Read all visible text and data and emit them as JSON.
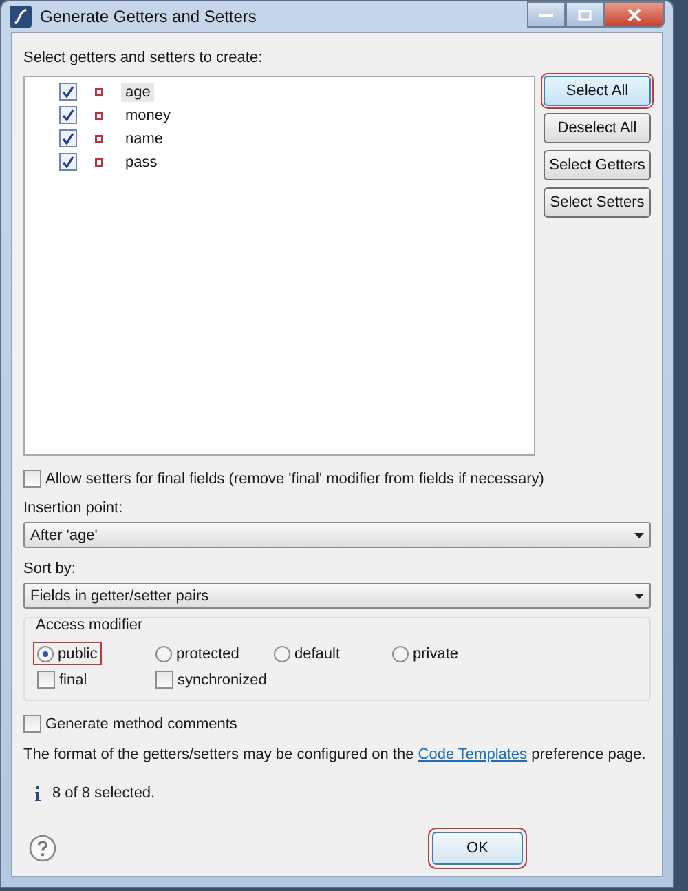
{
  "window": {
    "title": "Generate Getters and Setters"
  },
  "tree": {
    "label": "Select getters and setters to create:",
    "items": [
      {
        "name": "age",
        "checked": true,
        "selected": true
      },
      {
        "name": "money",
        "checked": true,
        "selected": false
      },
      {
        "name": "name",
        "checked": true,
        "selected": false
      },
      {
        "name": "pass",
        "checked": true,
        "selected": false
      }
    ]
  },
  "side_buttons": [
    {
      "label": "Select All",
      "focused": true
    },
    {
      "label": "Deselect All",
      "focused": false
    },
    {
      "label": "Select Getters",
      "focused": false
    },
    {
      "label": "Select Setters",
      "focused": false
    }
  ],
  "allow_final": {
    "label": "Allow setters for final fields (remove 'final' modifier from fields if necessary)",
    "checked": false
  },
  "insertion_point": {
    "label": "Insertion point:",
    "value": "After 'age'"
  },
  "sort_by": {
    "label": "Sort by:",
    "value": "Fields in getter/setter pairs"
  },
  "access_modifier": {
    "title": "Access modifier",
    "radios": [
      {
        "label": "public",
        "selected": true
      },
      {
        "label": "protected",
        "selected": false
      },
      {
        "label": "default",
        "selected": false
      },
      {
        "label": "private",
        "selected": false
      }
    ],
    "checkboxes": [
      {
        "label": "final",
        "checked": false
      },
      {
        "label": "synchronized",
        "checked": false
      }
    ]
  },
  "method_comments": {
    "label": "Generate method comments",
    "checked": false
  },
  "note": {
    "before": "The format of the getters/setters may be configured on the",
    "link": "Code Templates",
    "after": "preference page."
  },
  "status": "8 of 8 selected.",
  "ok_button": {
    "label": "OK",
    "focused": true
  }
}
